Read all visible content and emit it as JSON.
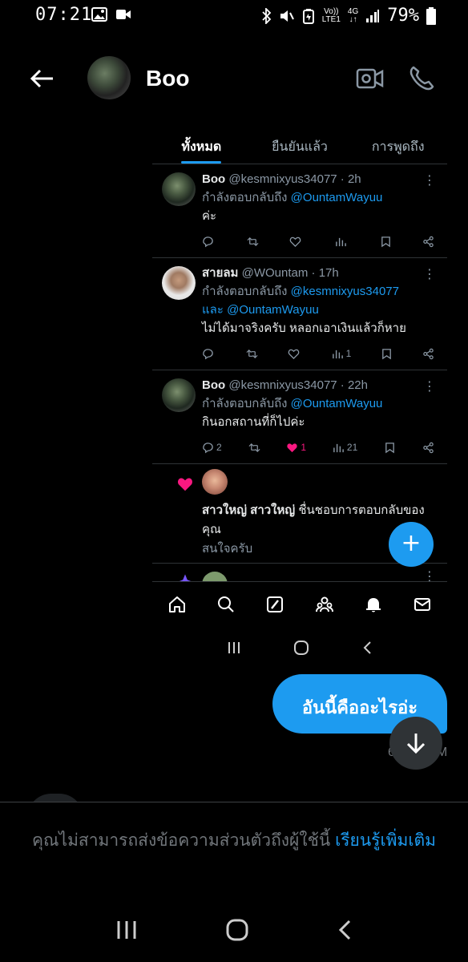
{
  "status_bar": {
    "time": "07:21",
    "network_top": "Vo))",
    "network_bottom": "LTE1",
    "network_type": "4G",
    "battery": "79%"
  },
  "header": {
    "contact_name": "Boo",
    "icons": [
      "back-arrow-icon",
      "video-call-icon",
      "phone-call-icon"
    ]
  },
  "shared_screenshot": {
    "tabs": [
      {
        "label": "ทั้งหมด",
        "active": true
      },
      {
        "label": "ยืนยันแล้ว",
        "active": false
      },
      {
        "label": "การพูดถึง",
        "active": false
      }
    ],
    "tweets": [
      {
        "name": "Boo",
        "handle_time": "@kesmnixyus34077 · 2h",
        "reply_prefix": "กำลังตอบกลับถึง",
        "reply_to_1": "@OuntamWayuu",
        "reply_and": "",
        "reply_to_2": "",
        "body": "ค่ะ",
        "replies": "",
        "likes": "",
        "views": ""
      },
      {
        "name": "สายลม",
        "handle_time": "@WOuntam · 17h",
        "reply_prefix": "กำลังตอบกลับถึง",
        "reply_to_1": "@kesmnixyus34077",
        "reply_and": "และ",
        "reply_to_2": "@OuntamWayuu",
        "body": "ไม่ได้มาจริงครับ หลอกเอาเงินแล้วก็หาย",
        "replies": "",
        "likes": "",
        "views": "1"
      },
      {
        "name": "Boo",
        "handle_time": "@kesmnixyus34077 · 22h",
        "reply_prefix": "กำลังตอบกลับถึง",
        "reply_to_1": "@OuntamWayuu",
        "reply_and": "",
        "reply_to_2": "",
        "body": "กินอกสถานที่ก็ไปค่ะ",
        "replies": "2",
        "likes": "1",
        "views": "21"
      }
    ],
    "notification": {
      "actor": "สาวใหญ่ สาวใหญ่",
      "action": " ชื่นชอบการตอบกลับของคุณ",
      "quoted": "สนใจครับ"
    },
    "fab_label": "+",
    "bottom_nav": [
      "home-icon",
      "search-icon",
      "grok-icon",
      "communities-icon",
      "notifications-icon",
      "messages-icon"
    ]
  },
  "chat": {
    "message": "อันนี้คืออะไรอ่ะ",
    "timestamp_fragment": "6",
    "timestamp_suffix": "M"
  },
  "notice": {
    "text": "คุณไม่สามารถส่งข้อความส่วนตัวถึงผู้ใช้นี้ ",
    "link": "เรียนรู้เพิ่มเติม"
  }
}
